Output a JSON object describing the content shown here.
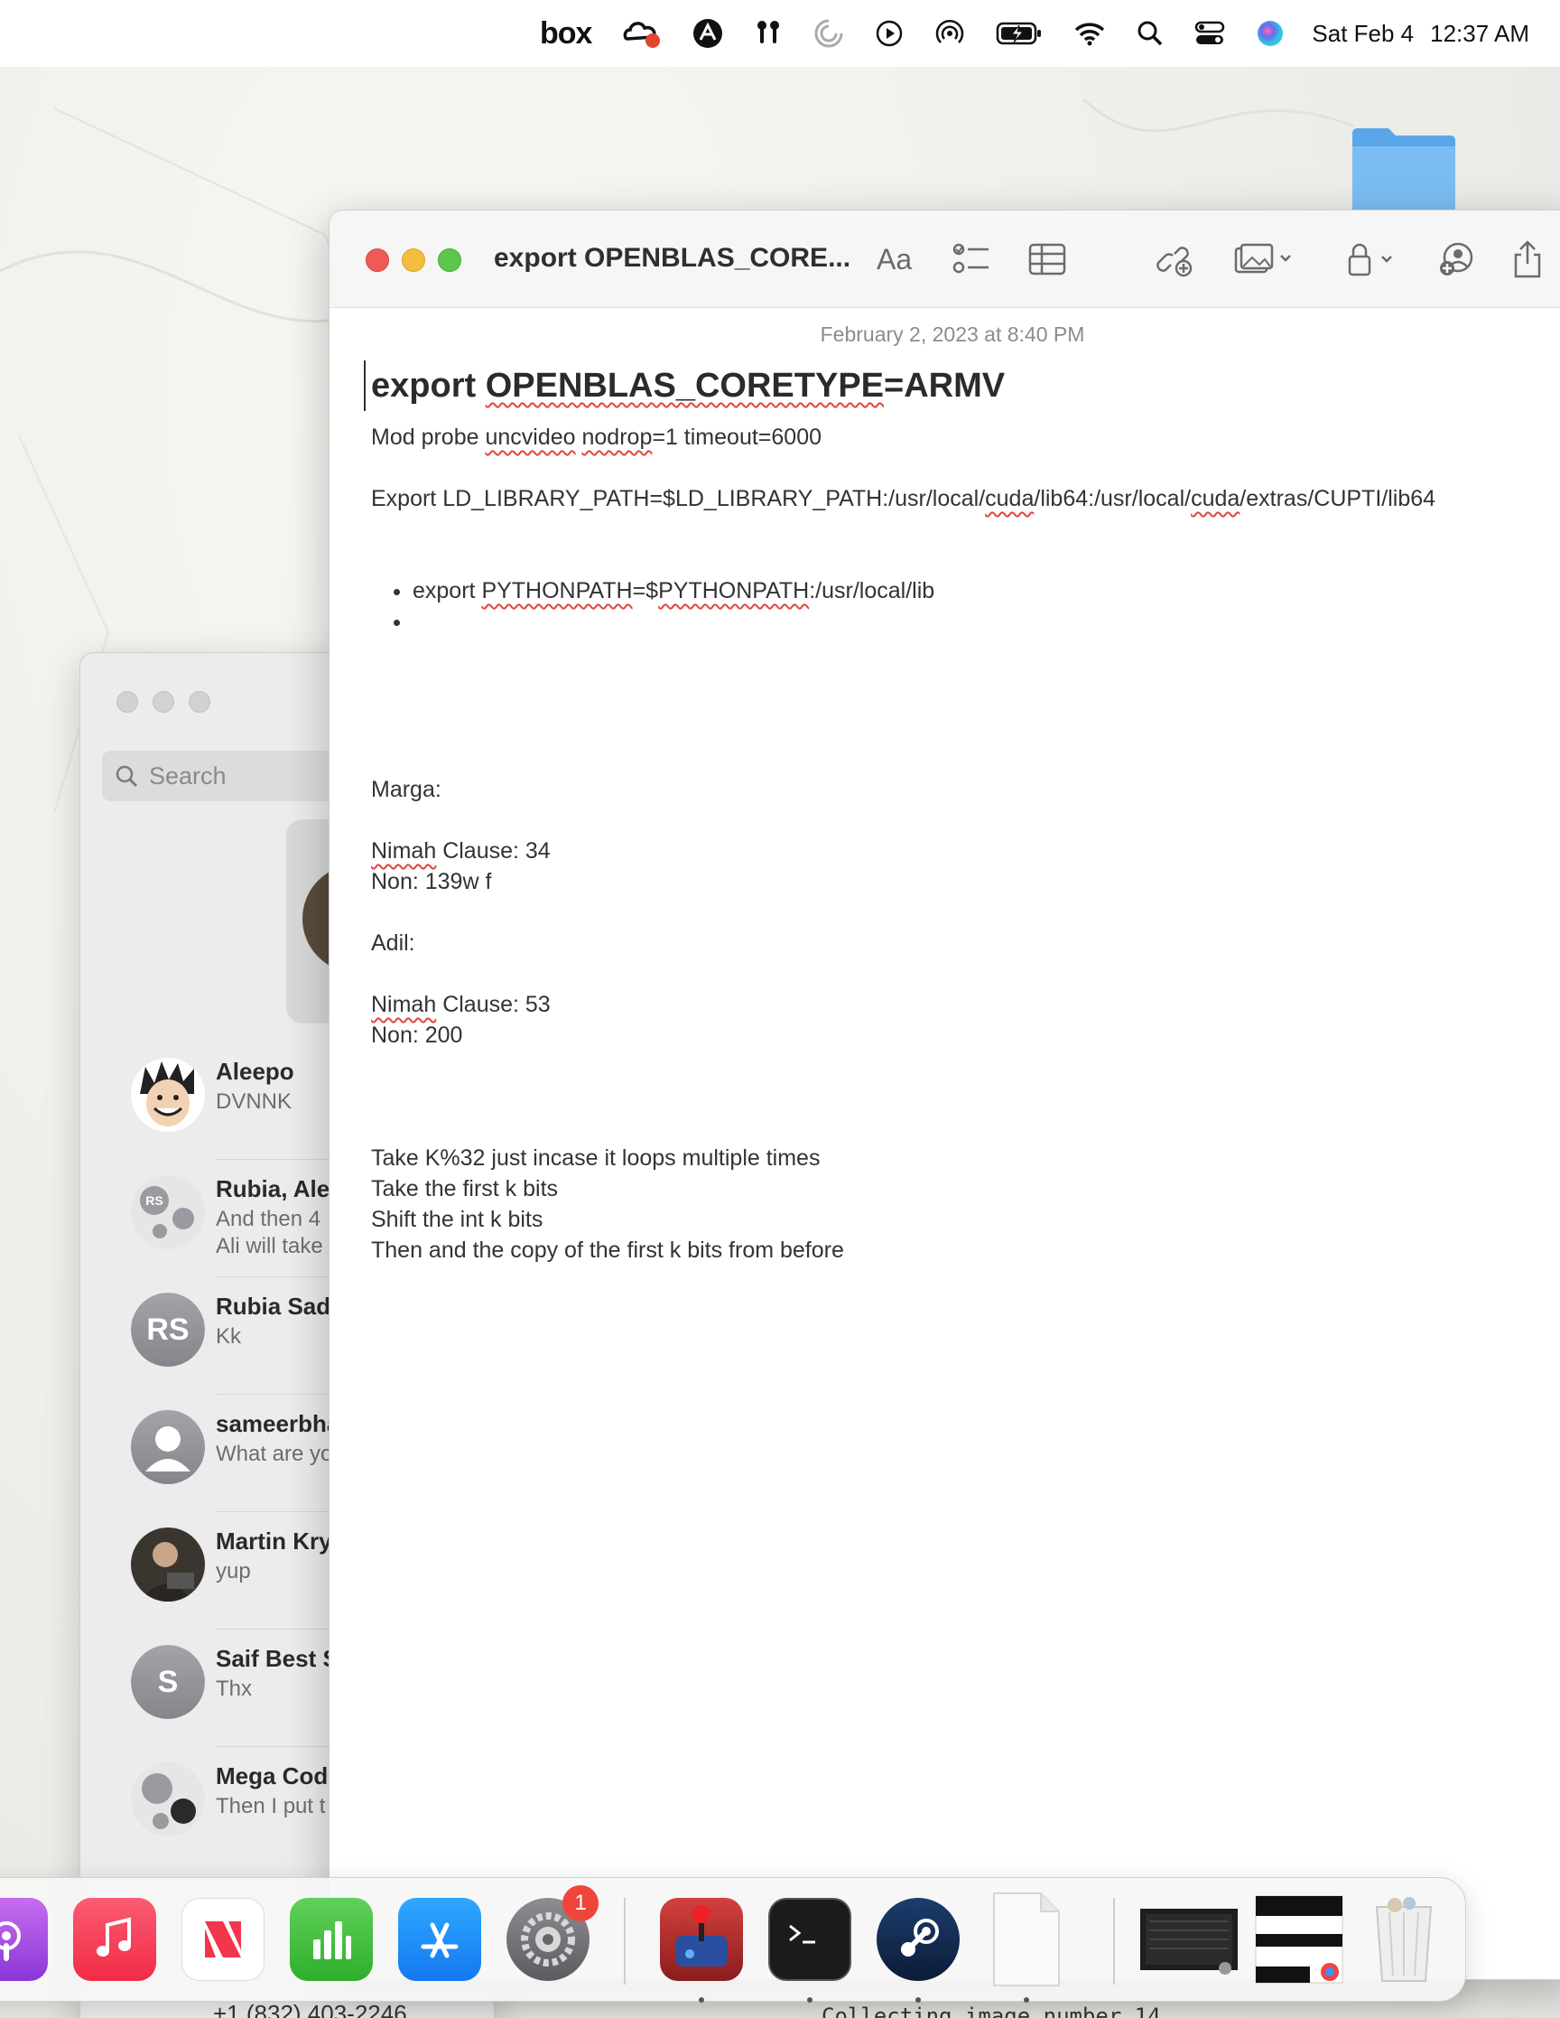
{
  "menubar": {
    "items": [
      "box-logo",
      "creative-cloud-icon",
      "app-icon",
      "airpods-icon",
      "sync-icon",
      "play-icon",
      "airdrop-icon",
      "battery-icon",
      "wifi-icon",
      "search-icon",
      "control-center-icon",
      "siri-icon"
    ],
    "box_label": "box",
    "date": "Sat Feb 4",
    "time": "12:37 AM"
  },
  "messages": {
    "search_placeholder": "Search",
    "conversations": [
      {
        "name": "Aleepo",
        "preview": "DVNNK"
      },
      {
        "name": "Rubia, Ale",
        "preview": "And then 4",
        "preview2": "Ali will take",
        "initials": "RS"
      },
      {
        "name": "Rubia Sad",
        "preview": "Kk",
        "initials": "RS"
      },
      {
        "name": "sameerbha",
        "preview": "What are yo"
      },
      {
        "name": "Martin Kry",
        "preview": "yup"
      },
      {
        "name": "Saif Best S",
        "preview": "Thx",
        "initials": "S"
      },
      {
        "name": "Mega Cod",
        "preview": "Then I put t"
      }
    ],
    "footer_phone": "+1 (832) 403-2246"
  },
  "notes": {
    "window_title": "export OPENBLAS_CORE...",
    "format_label": "Aa",
    "date": "February 2, 2023 at 8:40 PM",
    "heading": {
      "prefix": "export ",
      "squiggle": "OPENBLAS_CORETYPE",
      "suffix": "=ARMV"
    },
    "line1": {
      "a": "Mod probe ",
      "b": "uncvideo",
      "c": " ",
      "d": "nodrop",
      "e": "=1 timeout=6000"
    },
    "line2": {
      "a": "Export LD_LIBRARY_PATH=$LD_LIBRARY_PATH:/usr/local/",
      "b": "cuda",
      "c": "/lib64:/usr/local/",
      "d": "cuda",
      "e": "/extras/CUPTI/lib64"
    },
    "bullet1": {
      "a": "export ",
      "b": "PYTHONPATH",
      "c": "=$",
      "d": "PYTHONPATH",
      "e": ":/usr/local/lib"
    },
    "bullet2": "",
    "marga_label": "Marga:",
    "marga_clause": {
      "a": "Nimah",
      "b": " Clause: 34"
    },
    "marga_non": "Non: 139w f",
    "adil_label": "Adil:",
    "adil_clause": {
      "a": "Nimah",
      "b": " Clause: 53"
    },
    "adil_non": "Non: 200",
    "steps": [
      "Take K%32 just incase it loops multiple times",
      "Take the first k bits",
      "Shift the int k bits",
      "Then and the copy of the first k bits from before"
    ]
  },
  "dock": {
    "apps": [
      "podcasts-icon",
      "music-icon",
      "news-icon",
      "numbers-icon",
      "app-store-icon",
      "system-settings-icon",
      "joystick-app-icon",
      "terminal-icon",
      "steam-icon",
      "document-icon",
      "screen-thumbnail-1",
      "screen-thumbnail-2",
      "trash-icon"
    ],
    "settings_badge": "1"
  },
  "below_dock_text": "Collecting image number 14"
}
